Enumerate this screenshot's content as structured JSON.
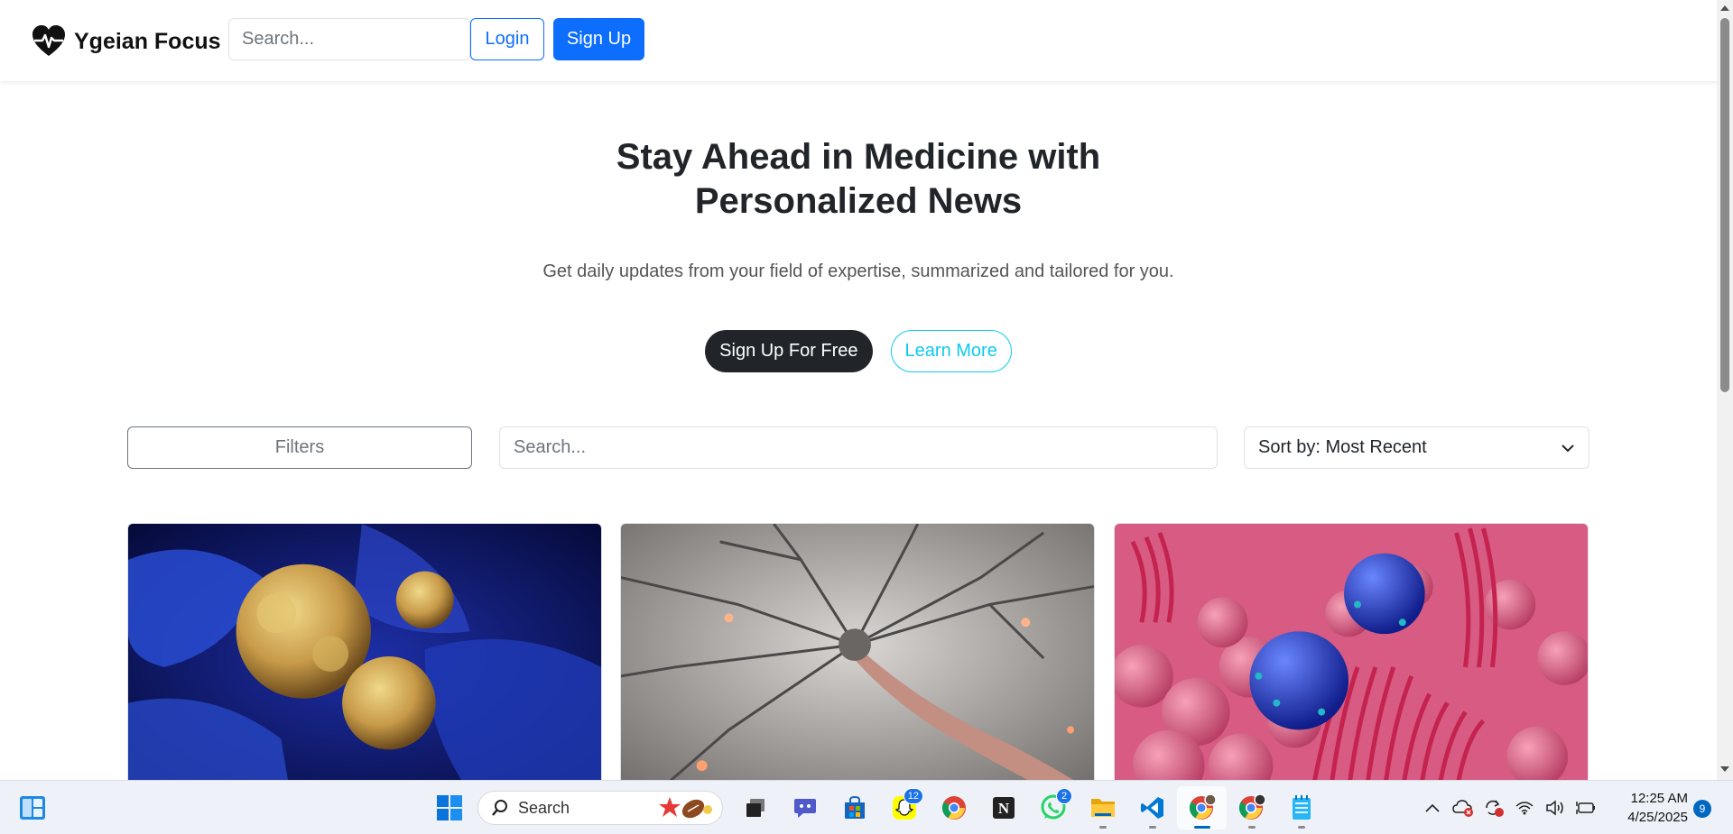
{
  "navbar": {
    "brand": "Ygeian Focus",
    "search_placeholder": "Search...",
    "login_label": "Login",
    "signup_label": "Sign Up"
  },
  "hero": {
    "title_line1": "Stay Ahead in Medicine with",
    "title_line2": "Personalized News",
    "subtitle": "Get daily updates from your field of expertise, summarized and tailored for you.",
    "cta_primary": "Sign Up For Free",
    "cta_secondary": "Learn More"
  },
  "toolbar": {
    "filters_label": "Filters",
    "search_placeholder": "Search...",
    "sort_label": "Sort by: Most Recent"
  },
  "cards": [
    {
      "image": "cancer-cells-illustration"
    },
    {
      "image": "neuron-illustration"
    },
    {
      "image": "intestinal-villi-bacteria-illustration"
    }
  ],
  "taskbar": {
    "search_label": "Search",
    "apps": [
      {
        "icon": "windows-start-icon"
      },
      {
        "icon": "task-view-icon"
      },
      {
        "icon": "teams-chat-icon"
      },
      {
        "icon": "microsoft-store-icon"
      },
      {
        "icon": "snapchat-icon",
        "badge": "12"
      },
      {
        "icon": "chrome-icon"
      },
      {
        "icon": "notion-icon"
      },
      {
        "icon": "whatsapp-icon",
        "badge": "2"
      },
      {
        "icon": "file-explorer-icon"
      },
      {
        "icon": "vscode-icon"
      },
      {
        "icon": "chrome-profile-icon"
      },
      {
        "icon": "chrome-profile-2-icon"
      },
      {
        "icon": "notepad-icon"
      }
    ],
    "clock_time": "12:25 AM",
    "clock_date": "4/25/2025",
    "notification_count": "9"
  },
  "colors": {
    "primary": "#0d6efd",
    "dark": "#212529",
    "info": "#0dcaf0",
    "secondary": "#6c757d"
  }
}
